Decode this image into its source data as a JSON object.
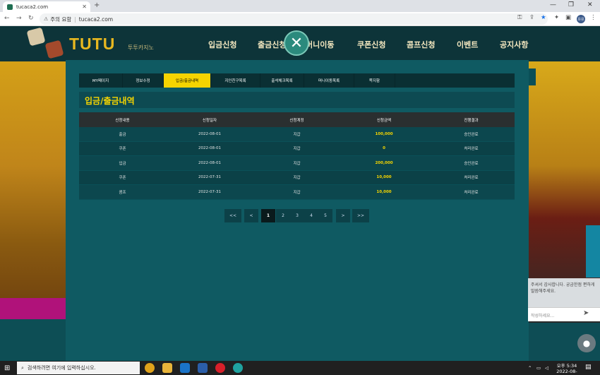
{
  "browser": {
    "tab_title": "tucaca2.com",
    "tab_close": "✕",
    "new_tab": "+",
    "win_min": "—",
    "win_max": "❐",
    "win_close": "✕",
    "nav_back": "←",
    "nav_forward": "→",
    "nav_reload": "↻",
    "security_label": "주의 요함",
    "url": "tucaca2.com",
    "profile_initial": "유유"
  },
  "header": {
    "logo": "TUTU",
    "logo_sub": "투투카지노",
    "nav": [
      "입금신청",
      "출금신청",
      "머니이동",
      "쿠폰신청",
      "콤프신청",
      "이벤트",
      "공지사항"
    ],
    "close_symbol": "✕"
  },
  "subnav": [
    "MY페이지",
    "정보수정",
    "입금/출금내역",
    "지인친구목록",
    "출석체크목록",
    "머니이동목록",
    "쪽지함"
  ],
  "page_title": "입금/출금내역",
  "table": {
    "headers": [
      "신청내용",
      "신청일자",
      "신청계정",
      "신청금액",
      "진행결과"
    ],
    "rows": [
      [
        "출금",
        "2022-08-01",
        "지갑",
        "100,000",
        "승인완료"
      ],
      [
        "쿠폰",
        "2022-08-01",
        "지갑",
        "0",
        "처리완료"
      ],
      [
        "입금",
        "2022-08-01",
        "지갑",
        "200,000",
        "승인완료"
      ],
      [
        "쿠폰",
        "2022-07-31",
        "지갑",
        "10,000",
        "처리완료"
      ],
      [
        "콤프",
        "2022-07-31",
        "지갑",
        "10,000",
        "처리완료"
      ]
    ]
  },
  "pagination": {
    "first": "<<",
    "prev": "<",
    "pages": [
      "1",
      "2",
      "3",
      "4",
      "5"
    ],
    "current": "1",
    "next": ">",
    "last": ">>"
  },
  "chat": {
    "message": "주셔서 감사합니다. 궁금한점 편하게 말씀해주세요.",
    "placeholder": "작성하세요...",
    "send_icon": "➤"
  },
  "taskbar": {
    "search_placeholder": "검색하려면 여기에 입력하십시오.",
    "time": "오후 5:34",
    "date": "2022-08-01"
  },
  "colors": {
    "accent": "#f5d400",
    "panel": "#0f5a62",
    "header_bg": "#0d3439"
  }
}
